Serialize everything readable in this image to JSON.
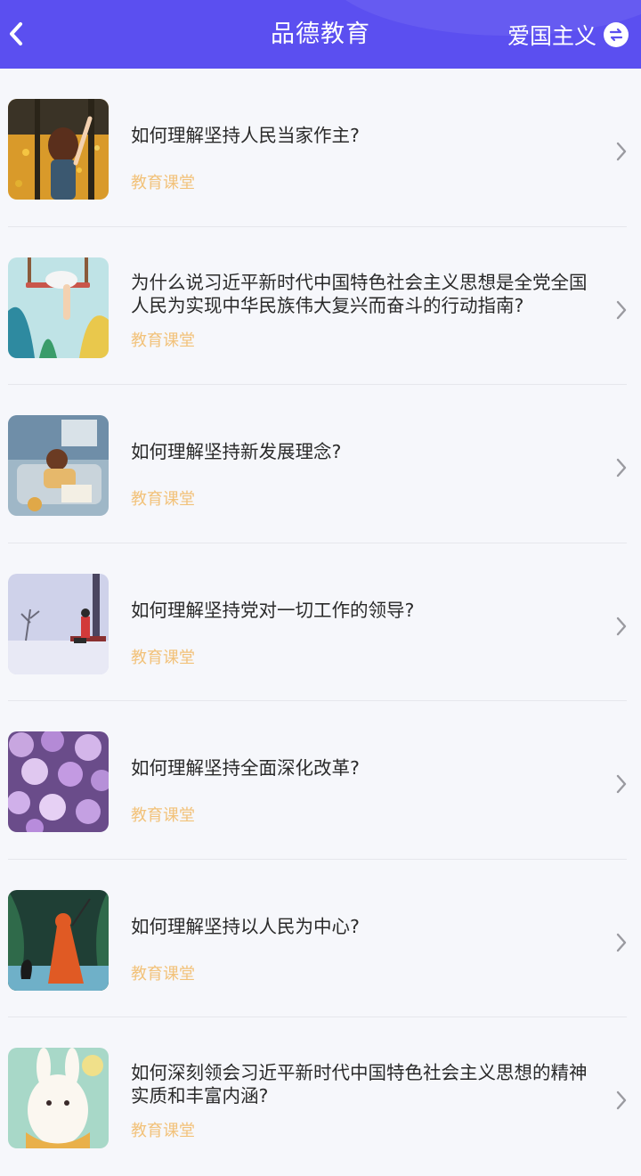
{
  "header": {
    "title": "品德教育",
    "category_label": "爱国主义",
    "back_icon": "chevron-left-icon",
    "switch_icon": "swap-icon"
  },
  "colors": {
    "header_bg": "#5b4ff0",
    "tag": "#f2c27a",
    "background": "#f6f7fb"
  },
  "items": [
    {
      "title": "如何理解坚持人民当家作主?",
      "tag": "教育课堂",
      "thumb": "girl-autumn-forest"
    },
    {
      "title": "为什么说习近平新时代中国特色社会主义思想是全党全国人民为实现中华民族伟大复兴而奋斗的行动指南?",
      "tag": "教育课堂",
      "thumb": "girl-on-swing"
    },
    {
      "title": "如何理解坚持新发展理念?",
      "tag": "教育课堂",
      "thumb": "girl-reading-nook"
    },
    {
      "title": "如何理解坚持党对一切工作的领导?",
      "tag": "教育课堂",
      "thumb": "girl-on-bench-snow"
    },
    {
      "title": "如何理解坚持全面深化改革?",
      "tag": "教育课堂",
      "thumb": "purple-flowers"
    },
    {
      "title": "如何理解坚持以人民为中心?",
      "tag": "教育课堂",
      "thumb": "red-hood-lake-swan"
    },
    {
      "title": "如何深刻领会习近平新时代中国特色社会主义思想的精神实质和丰富内涵?",
      "tag": "教育课堂",
      "thumb": "white-rabbit"
    }
  ]
}
